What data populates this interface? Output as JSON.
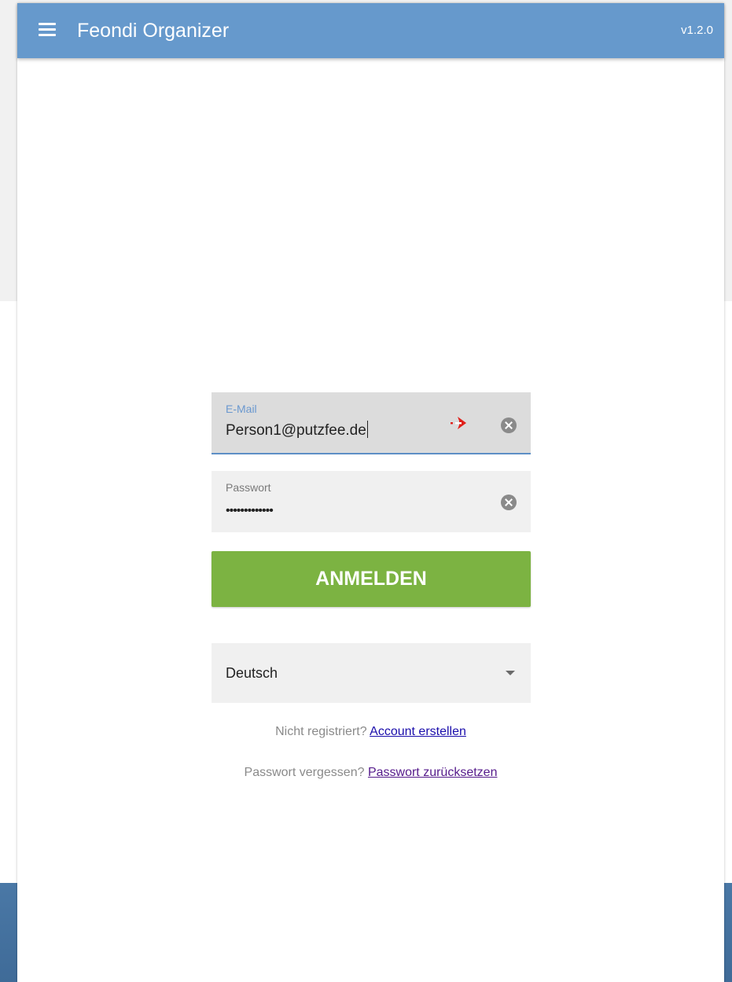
{
  "app": {
    "title": "Feondi Organizer",
    "version": "v1.2.0"
  },
  "login": {
    "email_label": "E-Mail",
    "email_value": "Person1@putzfee.de",
    "password_label": "Passwort",
    "password_masked": "•••••••••••••",
    "submit_label": "ANMELDEN"
  },
  "language": {
    "selected": "Deutsch"
  },
  "links": {
    "register_prompt": "Nicht registriert?",
    "register_link": "Account erstellen",
    "reset_prompt": "Passwort vergessen?",
    "reset_link": "Passwort zurücksetzen"
  },
  "icons": {
    "menu": "menu-icon",
    "clear": "clear-icon",
    "autofill": "autofill-icon",
    "dropdown": "chevron-down-icon"
  },
  "colors": {
    "appbar": "#6699cc",
    "primary_button": "#7cb342",
    "focus_underline": "#5d8fc6",
    "autofill_icon": "#e0201b"
  }
}
